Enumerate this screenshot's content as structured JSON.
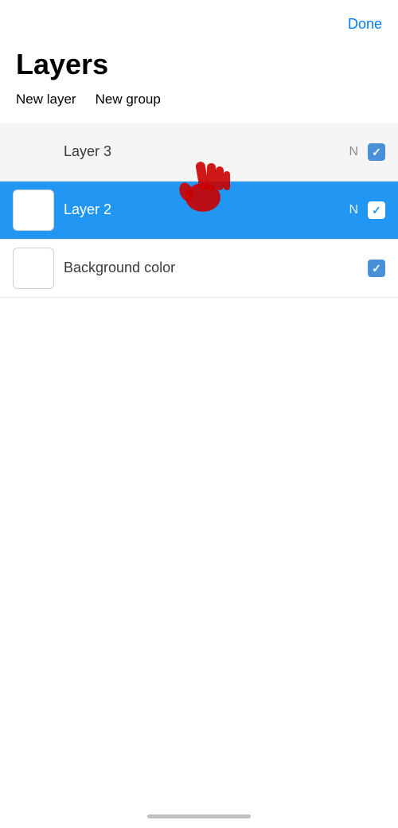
{
  "header": {
    "done_label": "Done"
  },
  "title": "Layers",
  "actions": {
    "new_layer_label": "New layer",
    "new_group_label": "New group"
  },
  "layers": [
    {
      "id": "layer3",
      "name": "Layer 3",
      "mode": "N",
      "checked": true,
      "active": false,
      "has_thumbnail": false
    },
    {
      "id": "layer2",
      "name": "Layer 2",
      "mode": "N",
      "checked": true,
      "active": true,
      "has_thumbnail": true
    },
    {
      "id": "background",
      "name": "Background color",
      "mode": "",
      "checked": true,
      "active": false,
      "has_thumbnail": true
    }
  ]
}
